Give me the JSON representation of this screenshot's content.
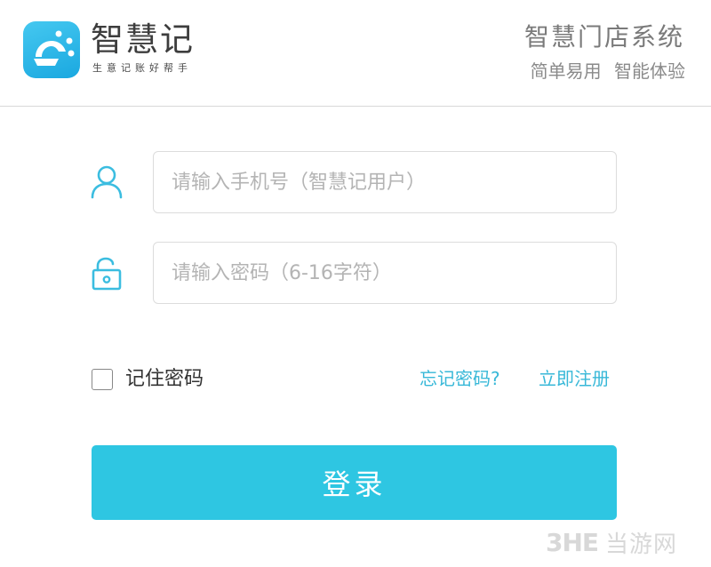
{
  "header": {
    "brand_name": "智慧记",
    "brand_slogan": "生意记账好帮手",
    "system_title": "智慧门店系统",
    "system_subtitle": "简单易用 智能体验"
  },
  "form": {
    "phone_placeholder": "请输入手机号（智慧记用户）",
    "password_placeholder": "请输入密码（6-16字符）",
    "remember_label": "记住密码",
    "forgot_label": "忘记密码?",
    "register_label": "立即注册",
    "login_label": "登录"
  },
  "watermark": {
    "logo": "3HE",
    "text": "当游网"
  },
  "colors": {
    "accent": "#2ec6e2",
    "link": "#38b8d8",
    "icon": "#3bbde0"
  }
}
